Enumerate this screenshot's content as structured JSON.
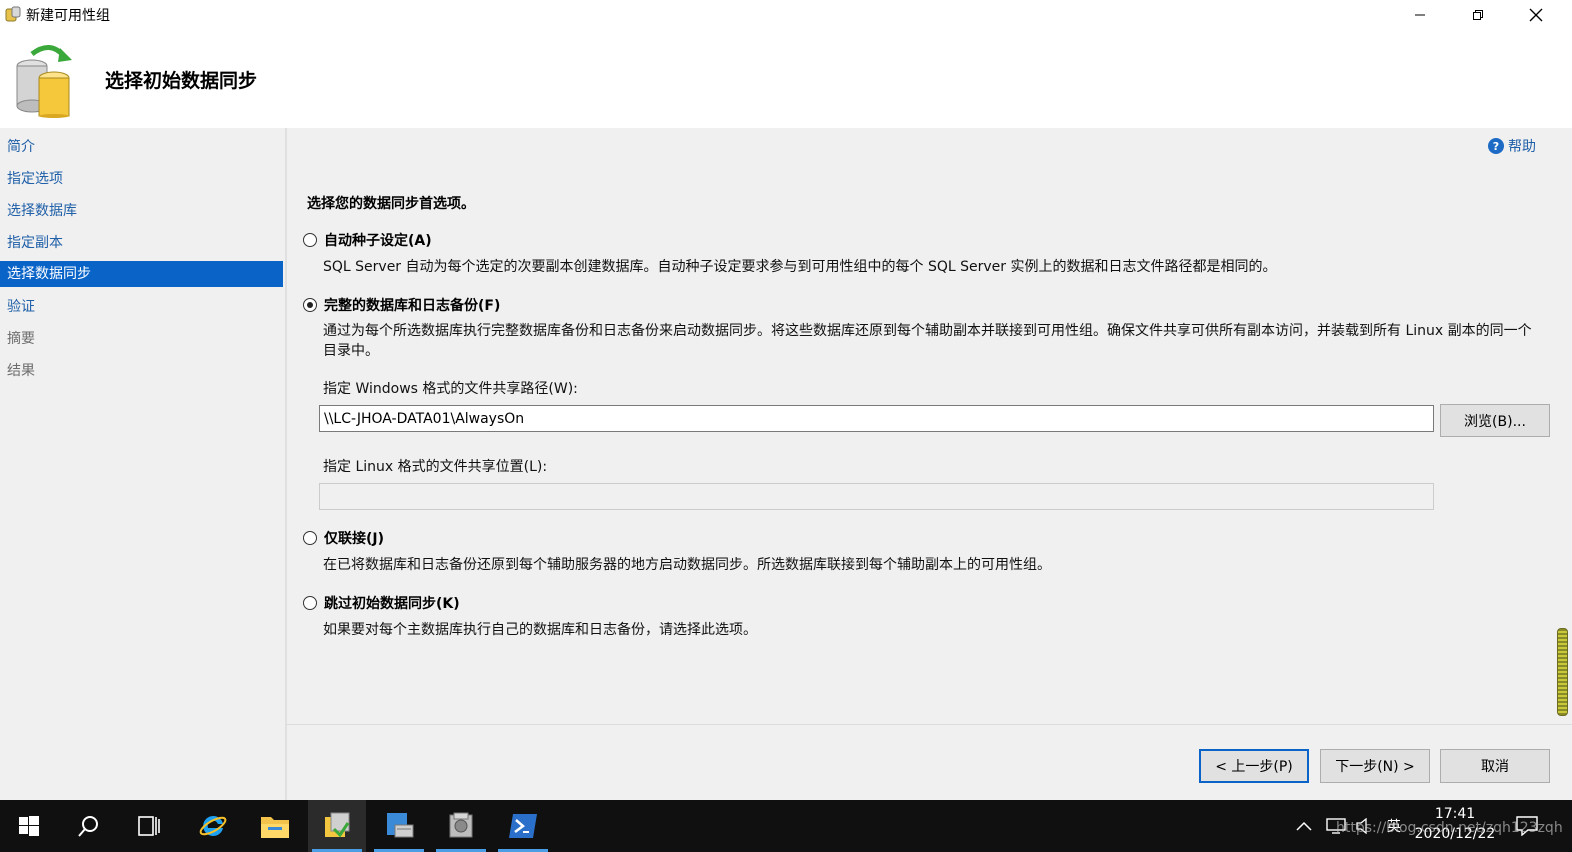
{
  "window": {
    "title": "新建可用性组",
    "controls": {
      "minimize_icon": "minimize-icon",
      "maximize_icon": "restore-icon",
      "close_icon": "close-icon"
    }
  },
  "header": {
    "title": "选择初始数据同步",
    "icon": "database-sync-icon"
  },
  "sidebar": {
    "items": [
      {
        "label": "简介",
        "state": "link"
      },
      {
        "label": "指定选项",
        "state": "link"
      },
      {
        "label": "选择数据库",
        "state": "link"
      },
      {
        "label": "指定副本",
        "state": "link"
      },
      {
        "label": "选择数据同步",
        "state": "selected"
      },
      {
        "label": "验证",
        "state": "link"
      },
      {
        "label": "摘要",
        "state": "disabled"
      },
      {
        "label": "结果",
        "state": "disabled"
      }
    ]
  },
  "main": {
    "help_label": "帮助",
    "prompt": "选择您的数据同步首选项。",
    "options": [
      {
        "label": "自动种子设定(A)",
        "checked": false,
        "description": "SQL Server 自动为每个选定的次要副本创建数据库。自动种子设定要求参与到可用性组中的每个 SQL Server 实例上的数据和日志文件路径都是相同的。"
      },
      {
        "label": "完整的数据库和日志备份(F)",
        "checked": true,
        "description": "通过为每个所选数据库执行完整数据库备份和日志备份来启动数据同步。将这些数据库还原到每个辅助副本并联接到可用性组。确保文件共享可供所有副本访问，并装载到所有 Linux 副本的同一个目录中。"
      },
      {
        "label": "仅联接(J)",
        "checked": false,
        "description": "在已将数据库和日志备份还原到每个辅助服务器的地方启动数据同步。所选数据库联接到每个辅助副本上的可用性组。"
      },
      {
        "label": "跳过初始数据同步(K)",
        "checked": false,
        "description": "如果要对每个主数据库执行自己的数据库和日志备份，请选择此选项。"
      }
    ],
    "windows_share": {
      "label": "指定 Windows 格式的文件共享路径(W):",
      "value": "\\\\LC-JHOA-DATA01\\AlwaysOn",
      "browse_label": "浏览(B)..."
    },
    "linux_share": {
      "label": "指定 Linux 格式的文件共享位置(L):",
      "value": ""
    }
  },
  "footer": {
    "back_label": "< 上一步(P)",
    "next_label": "下一步(N) >",
    "cancel_label": "取消"
  },
  "taskbar": {
    "apps": [
      {
        "name": "start-icon"
      },
      {
        "name": "search-icon"
      },
      {
        "name": "task-view-icon"
      },
      {
        "name": "internet-explorer-icon"
      },
      {
        "name": "file-explorer-icon"
      },
      {
        "name": "sql-server-management-studio-icon"
      },
      {
        "name": "server-manager-icon"
      },
      {
        "name": "sql-server-configuration-icon"
      },
      {
        "name": "powershell-icon"
      }
    ],
    "tray": {
      "ime_label": "英",
      "time": "17:41",
      "date": "2020/12/22"
    },
    "watermark": "https://blog.csdn.net/zqh123zqh"
  }
}
